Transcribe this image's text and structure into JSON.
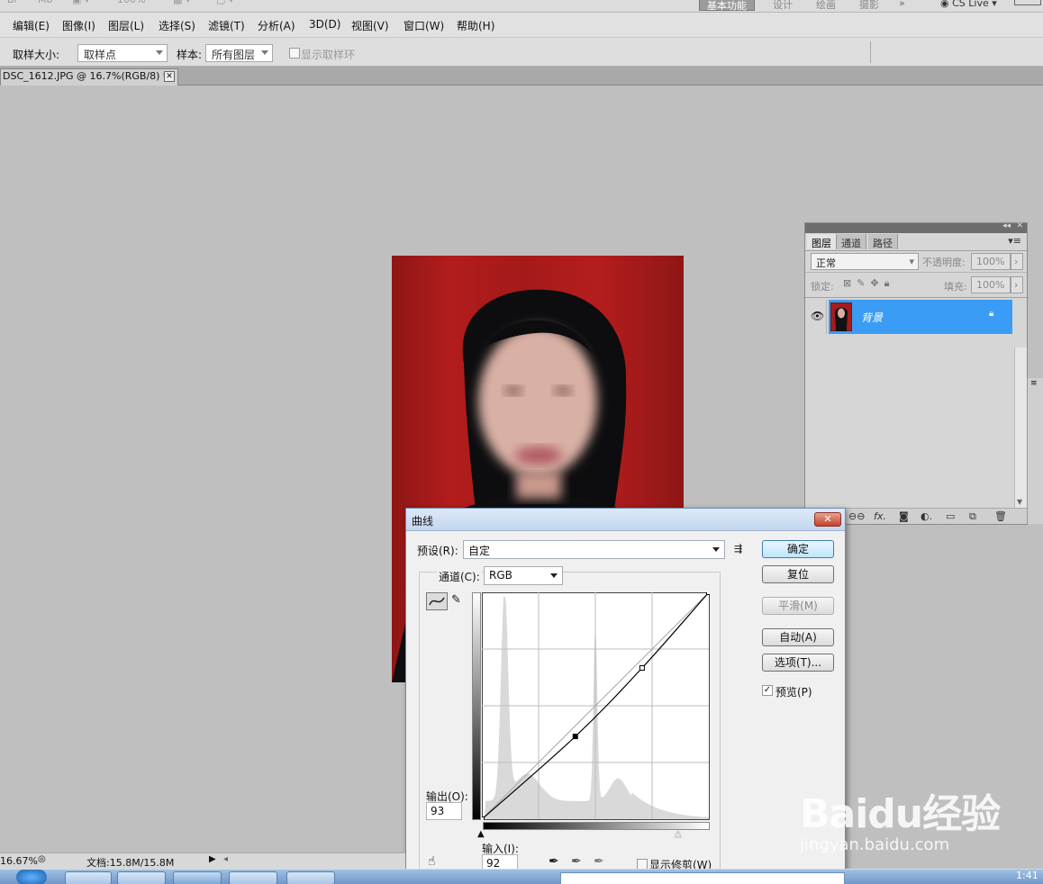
{
  "app": {
    "view_buttons": [
      "Br",
      "Mb"
    ],
    "zoom_readout": "100%",
    "workspaces": [
      "基本功能",
      "设计",
      "绘画",
      "摄影"
    ],
    "cs_live": "CS Live"
  },
  "menu": [
    "编辑(E)",
    "图像(I)",
    "图层(L)",
    "选择(S)",
    "滤镜(T)",
    "分析(A)",
    "3D(D)",
    "视图(V)",
    "窗口(W)",
    "帮助(H)"
  ],
  "options": {
    "sample_size_label": "取样大小:",
    "sample_size_value": "取样点",
    "sample_label": "样本:",
    "sample_value": "所有图层",
    "show_ring_label": "显示取样环"
  },
  "document": {
    "tab_title": "DSC_1612.JPG @ 16.7%(RGB/8) *",
    "zoom": "16.67%",
    "doc_size": "文档:15.8M/15.8M"
  },
  "layers_panel": {
    "tabs": [
      "图层",
      "通道",
      "路径"
    ],
    "blend_mode": "正常",
    "opacity_label": "不透明度:",
    "opacity_value": "100%",
    "lock_label": "锁定:",
    "fill_label": "填充:",
    "fill_value": "100%",
    "layer_name": "背景"
  },
  "curves_dialog": {
    "title": "曲线",
    "preset_label": "预设(R):",
    "preset_value": "自定",
    "channel_label": "通道(C):",
    "channel_value": "RGB",
    "output_label": "输出(O):",
    "output_value": "93",
    "input_label": "输入(I):",
    "input_value": "92",
    "show_clipping_label": "显示修剪(W)",
    "buttons": {
      "ok": "确定",
      "reset": "复位",
      "smooth": "平滑(M)",
      "auto": "自动(A)",
      "options": "选项(T)..."
    },
    "preview_label": "预览(P)",
    "preview_checked": true,
    "curve_points": [
      [
        0,
        0
      ],
      [
        35,
        93
      ],
      [
        60,
        170
      ],
      [
        85,
        255
      ]
    ],
    "colors": {
      "histogram": "#d9d9d9",
      "grid": "#bdbdbd",
      "curve": "#000000"
    }
  },
  "taskbar": {
    "clock": "1:41"
  },
  "watermark": {
    "brand": "Baidu经验",
    "url": "jingyan.baidu.com"
  }
}
